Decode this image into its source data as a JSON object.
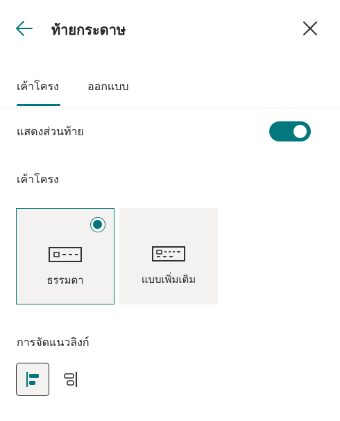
{
  "header": {
    "title": "ท้ายกระดาษ",
    "back_icon": "arrow-left-icon",
    "close_icon": "close-icon"
  },
  "tabs": [
    {
      "label": "เค้าโครง",
      "selected": true
    },
    {
      "label": "ออกแบบ",
      "selected": false
    }
  ],
  "show_footer": {
    "label": "แสดงส่วนท้าย",
    "on": true
  },
  "layout": {
    "heading": "เค้าโครง",
    "options": [
      {
        "label": "ธรรมดา",
        "icon": "simple-footer-icon",
        "selected": true
      },
      {
        "label": "แบบเพิ่มเติม",
        "icon": "extended-footer-icon",
        "selected": false
      }
    ]
  },
  "link_alignment": {
    "heading": "การจัดแนวลิงก์",
    "options": [
      {
        "icon": "align-left-icon",
        "selected": true
      },
      {
        "icon": "align-center-icon",
        "selected": false
      }
    ]
  },
  "colors": {
    "accent": "#03787c",
    "card_bg": "#f3f2f1",
    "text": "#252423"
  }
}
